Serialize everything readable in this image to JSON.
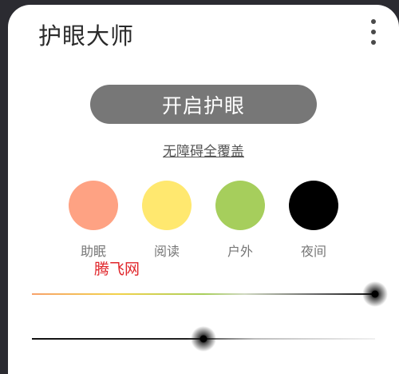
{
  "app": {
    "title": "护眼大师",
    "menu_icon": "more-vert-icon"
  },
  "main": {
    "toggle_label": "开启护眼",
    "overlay_link": "无障碍全覆盖"
  },
  "modes": [
    {
      "label": "助眠",
      "color": "#fea283"
    },
    {
      "label": "阅读",
      "color": "#ffe86f"
    },
    {
      "label": "户外",
      "color": "#a6ce5c"
    },
    {
      "label": "夜间",
      "color": "#000000"
    }
  ],
  "watermark": "腾飞网",
  "sliders": {
    "filter_strength": 1.0,
    "brightness": 0.5
  }
}
